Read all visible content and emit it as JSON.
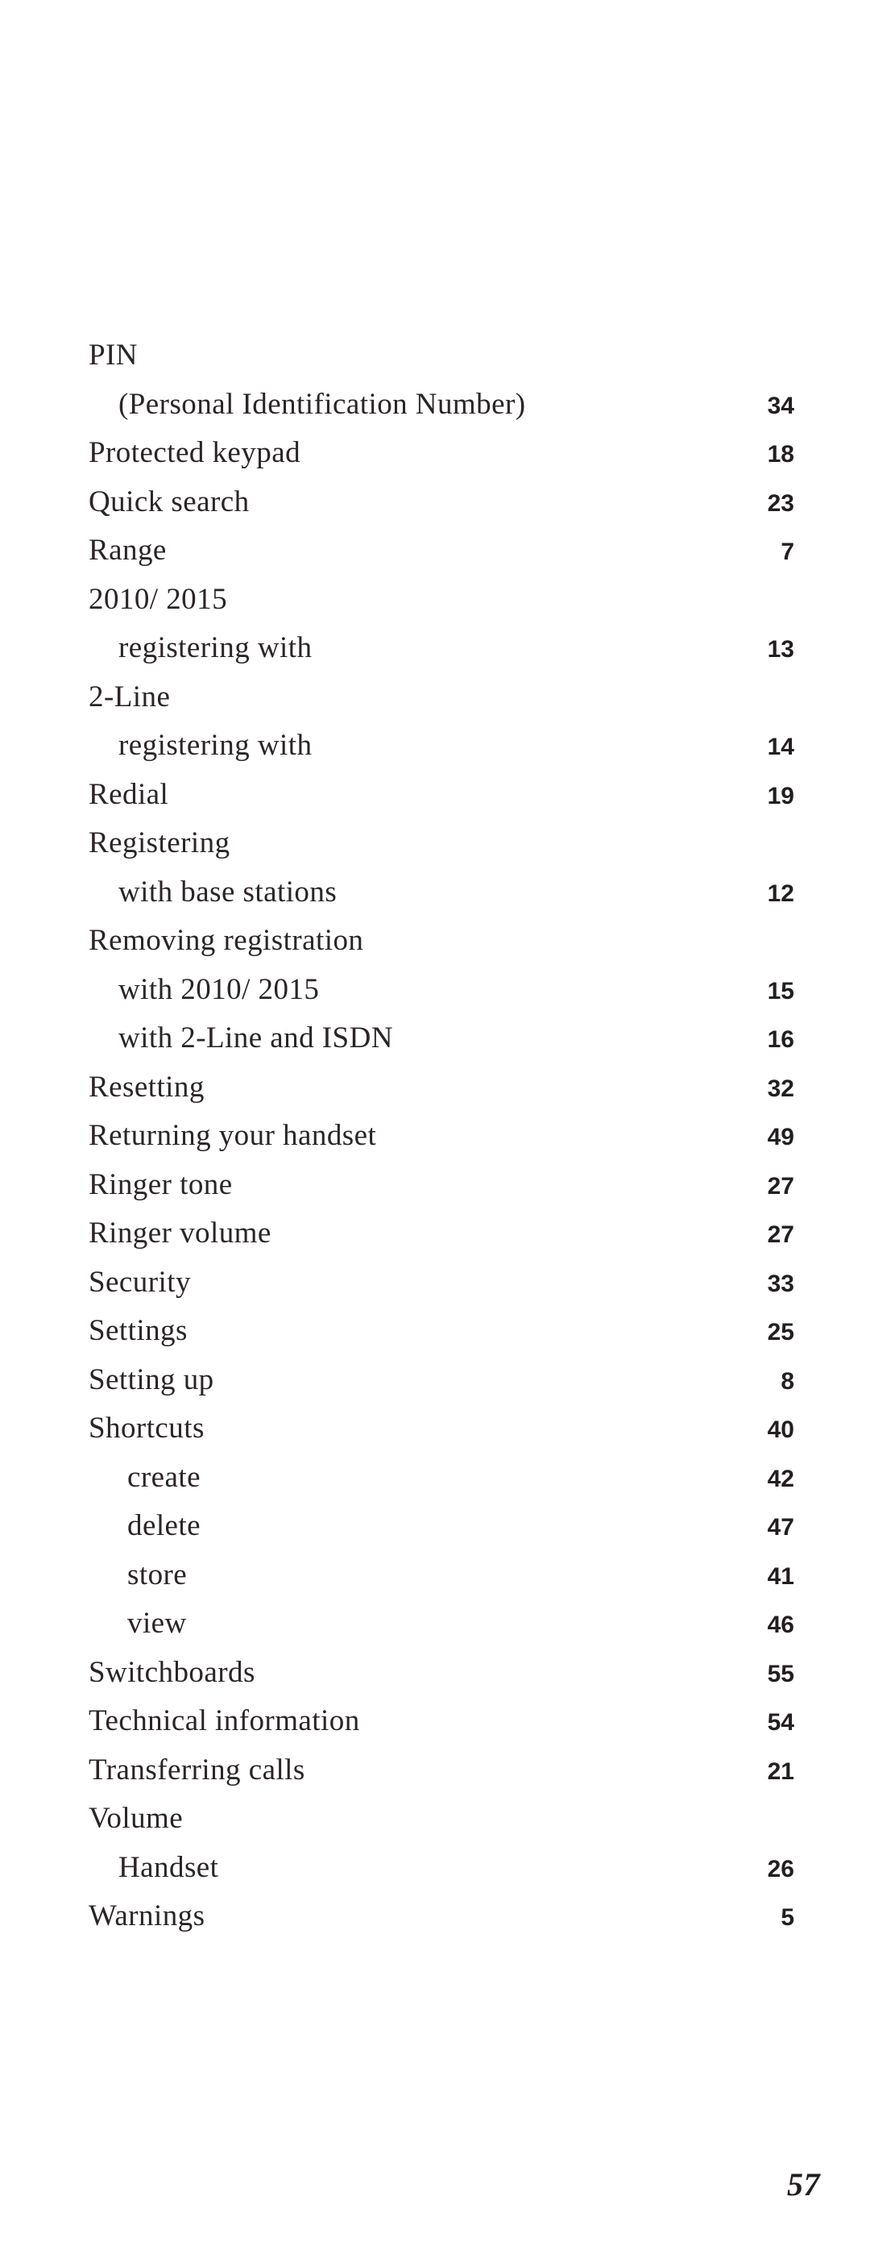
{
  "document": {
    "type": "book-index-page",
    "folio": "57",
    "background_color": "#ffffff",
    "text_color": "#2b2428",
    "page_number_color": "#231e21"
  },
  "index": {
    "entries": [
      {
        "label": "PIN",
        "page": "",
        "level": 0
      },
      {
        "label": "(Personal Identification Number)",
        "page": "34",
        "level": 1
      },
      {
        "label": "Protected keypad",
        "page": "18",
        "level": 0
      },
      {
        "label": "Quick search",
        "page": "23",
        "level": 0
      },
      {
        "label": "Range",
        "page": "7",
        "level": 0
      },
      {
        "label": "2010/ 2015",
        "page": "",
        "level": 0
      },
      {
        "label": "registering with",
        "page": "13",
        "level": 1
      },
      {
        "label": "2-Line",
        "page": "",
        "level": 0
      },
      {
        "label": "registering with",
        "page": "14",
        "level": 1
      },
      {
        "label": "Redial",
        "page": "19",
        "level": 0
      },
      {
        "label": "Registering",
        "page": "",
        "level": 0
      },
      {
        "label": "with base stations",
        "page": "12",
        "level": 1
      },
      {
        "label": "Removing registration",
        "page": "",
        "level": 0
      },
      {
        "label": "with 2010/ 2015",
        "page": "15",
        "level": 1
      },
      {
        "label": "with 2-Line and ISDN",
        "page": "16",
        "level": 1
      },
      {
        "label": "Resetting",
        "page": "32",
        "level": 0
      },
      {
        "label": "Returning your handset",
        "page": "49",
        "level": 0
      },
      {
        "label": "Ringer tone",
        "page": "27",
        "level": 0
      },
      {
        "label": "Ringer volume",
        "page": "27",
        "level": 0
      },
      {
        "label": "Security",
        "page": "33",
        "level": 0
      },
      {
        "label": "Settings",
        "page": "25",
        "level": 0
      },
      {
        "label": "Setting up",
        "page": "8",
        "level": 0
      },
      {
        "label": "Shortcuts",
        "page": "40",
        "level": 0
      },
      {
        "label": "create",
        "page": "42",
        "level": 2
      },
      {
        "label": "delete",
        "page": "47",
        "level": 2
      },
      {
        "label": "store",
        "page": "41",
        "level": 2
      },
      {
        "label": "view",
        "page": "46",
        "level": 2
      },
      {
        "label": "Switchboards",
        "page": "55",
        "level": 0
      },
      {
        "label": "Technical information",
        "page": "54",
        "level": 0
      },
      {
        "label": "Transferring calls",
        "page": "21",
        "level": 0
      },
      {
        "label": "Volume",
        "page": "",
        "level": 0
      },
      {
        "label": "Handset",
        "page": "26",
        "level": 1
      },
      {
        "label": "Warnings",
        "page": "5",
        "level": 0
      }
    ]
  }
}
